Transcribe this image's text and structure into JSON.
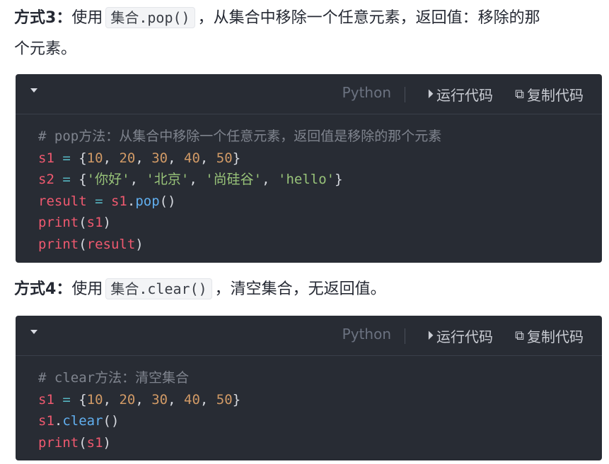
{
  "section3": {
    "title": "方式3",
    "colon": "：",
    "use": "使用",
    "code": "集合.pop()",
    "desc_line1": "，从集合中移除一个任意元素，返回值：移除的那",
    "desc_line2": "个元素。"
  },
  "section4": {
    "title": "方式4",
    "colon": "：",
    "use": "使用",
    "code": "集合.clear()",
    "desc": "，清空集合，无返回值。"
  },
  "codeblock1": {
    "language": "Python",
    "run_label": "运行代码",
    "copy_label": "复制代码",
    "lines": [
      {
        "comment": "# pop方法：从集合中移除一个任意元素，返回值是移除的那个元素"
      },
      {
        "var": "s1",
        "op": " = ",
        "nums": [
          "10",
          "20",
          "30",
          "40",
          "50"
        ]
      },
      {
        "var": "s2",
        "op": " = ",
        "strs": [
          "'你好'",
          "'北京'",
          "'尚硅谷'",
          "'hello'"
        ]
      },
      {
        "var": "result",
        "op": " = ",
        "obj": "s1",
        "method": "pop",
        "args": "()"
      },
      {
        "fn": "print",
        "arg": "s1"
      },
      {
        "fn": "print",
        "arg": "result"
      }
    ]
  },
  "codeblock2": {
    "language": "Python",
    "run_label": "运行代码",
    "copy_label": "复制代码",
    "lines": [
      {
        "comment": "# clear方法：清空集合"
      },
      {
        "var": "s1",
        "op": " = ",
        "nums": [
          "10",
          "20",
          "30",
          "40",
          "50"
        ]
      },
      {
        "obj": "s1",
        "method": "clear",
        "args": "()"
      },
      {
        "fn": "print",
        "arg": "s1"
      }
    ]
  },
  "icons": {
    "run": "play-circle-icon",
    "copy": "copy-icon",
    "toggle": "caret-down-icon"
  }
}
